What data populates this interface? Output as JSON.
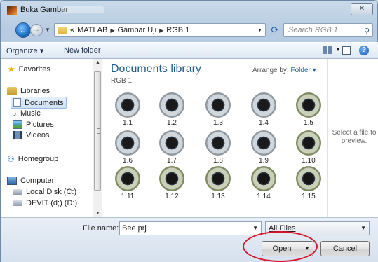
{
  "window": {
    "title": "Buka Gambar",
    "close_label": "✕"
  },
  "address": {
    "prefix": "«",
    "crumbs": [
      "MATLAB",
      "Gambar Uji",
      "RGB 1"
    ],
    "search_placeholder": "Search RGB 1"
  },
  "toolbar": {
    "organize_label": "Organize ▾",
    "new_folder_label": "New folder",
    "help_label": "?"
  },
  "nav": {
    "favorites": "Favorites",
    "libraries": "Libraries",
    "documents": "Documents",
    "music": "Music",
    "pictures": "Pictures",
    "videos": "Videos",
    "homegroup": "Homegroup",
    "computer": "Computer",
    "local_disk": "Local Disk (C:)",
    "devit": "DEVIT (d;) (D:)"
  },
  "library": {
    "title": "Documents library",
    "subtitle": "RGB 1",
    "arrange_label": "Arrange by:",
    "arrange_value": "Folder ▾"
  },
  "files": [
    "1.1",
    "1.2",
    "1.3",
    "1.4",
    "1.5",
    "1.6",
    "1.7",
    "1.8",
    "1.9",
    "1.10",
    "1.11",
    "1.12",
    "1.13",
    "1.14",
    "1.15"
  ],
  "preview": {
    "text": "Select a file to preview."
  },
  "bottom": {
    "file_name_label": "File name:",
    "file_name_value": "Bee.prj",
    "filter_value": "All Files",
    "open_label": "Open",
    "cancel_label": "Cancel"
  },
  "colors": {
    "accent": "#1e5b8f",
    "highlight": "#d9152a"
  }
}
